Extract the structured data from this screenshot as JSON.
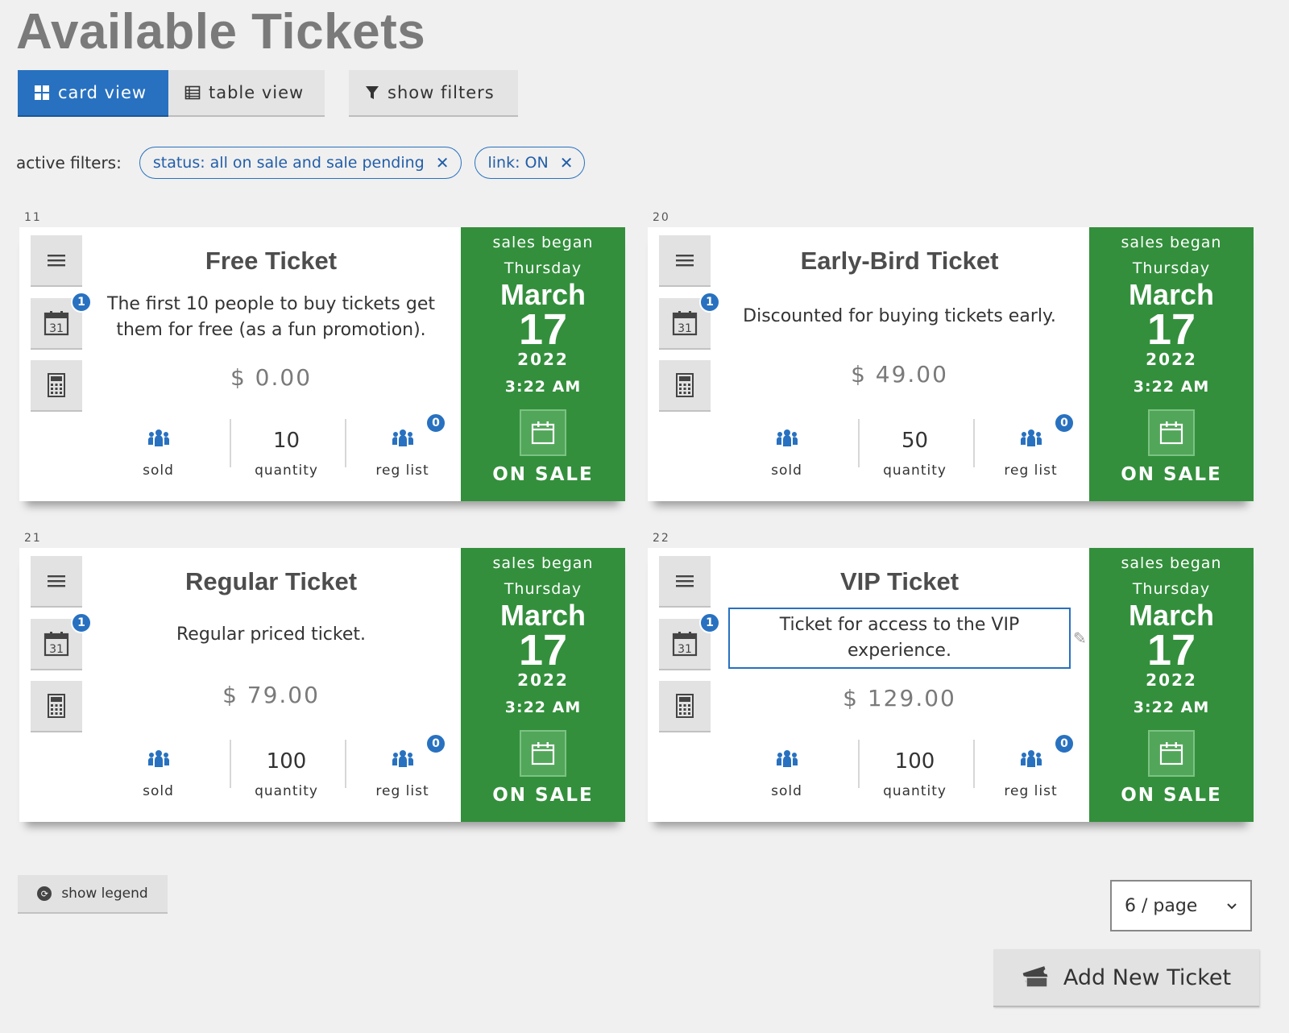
{
  "page": {
    "title": "Available Tickets"
  },
  "toolbar": {
    "card_view_label": "card view",
    "table_view_label": "table view",
    "show_filters_label": "show filters",
    "active_view": "card view"
  },
  "filters": {
    "label": "active filters:",
    "chips": [
      {
        "label": "status: all on sale and sale pending"
      },
      {
        "label": "link: ON"
      }
    ]
  },
  "tickets": [
    {
      "id": "11",
      "name": "Free Ticket",
      "description": "The first 10 people to buy tickets get them for free (as a fun promotion).",
      "price": "$ 0.00",
      "quantity": "10",
      "datetime_badge": "1",
      "reg_list_badge": "0",
      "sales_began": "sales began",
      "day": "Thursday",
      "month": "March",
      "date": "17",
      "year": "2022",
      "time": "3:22 AM",
      "status": "ON SALE"
    },
    {
      "id": "20",
      "name": "Early-Bird Ticket",
      "description": "Discounted for buying tickets early.",
      "price": "$ 49.00",
      "quantity": "50",
      "datetime_badge": "1",
      "reg_list_badge": "0",
      "sales_began": "sales began",
      "day": "Thursday",
      "month": "March",
      "date": "17",
      "year": "2022",
      "time": "3:22 AM",
      "status": "ON SALE"
    },
    {
      "id": "21",
      "name": "Regular Ticket",
      "description": "Regular priced ticket.",
      "price": "$ 79.00",
      "quantity": "100",
      "datetime_badge": "1",
      "reg_list_badge": "0",
      "sales_began": "sales began",
      "day": "Thursday",
      "month": "March",
      "date": "17",
      "year": "2022",
      "time": "3:22 AM",
      "status": "ON SALE"
    },
    {
      "id": "22",
      "name": "VIP Ticket",
      "description": "Ticket for access to the VIP experience.",
      "price": "$ 129.00",
      "quantity": "100",
      "datetime_badge": "1",
      "reg_list_badge": "0",
      "sales_began": "sales began",
      "day": "Thursday",
      "month": "March",
      "date": "17",
      "year": "2022",
      "time": "3:22 AM",
      "status": "ON SALE"
    }
  ],
  "stats_labels": {
    "sold": "sold",
    "quantity": "quantity",
    "reg_list": "reg list"
  },
  "footer": {
    "legend_label": "show legend",
    "per_page_label": "6 / page",
    "add_label": "Add New Ticket"
  },
  "colors": {
    "accent": "#2871c0",
    "on_sale": "#338f3c",
    "background": "#f0f0f0"
  }
}
